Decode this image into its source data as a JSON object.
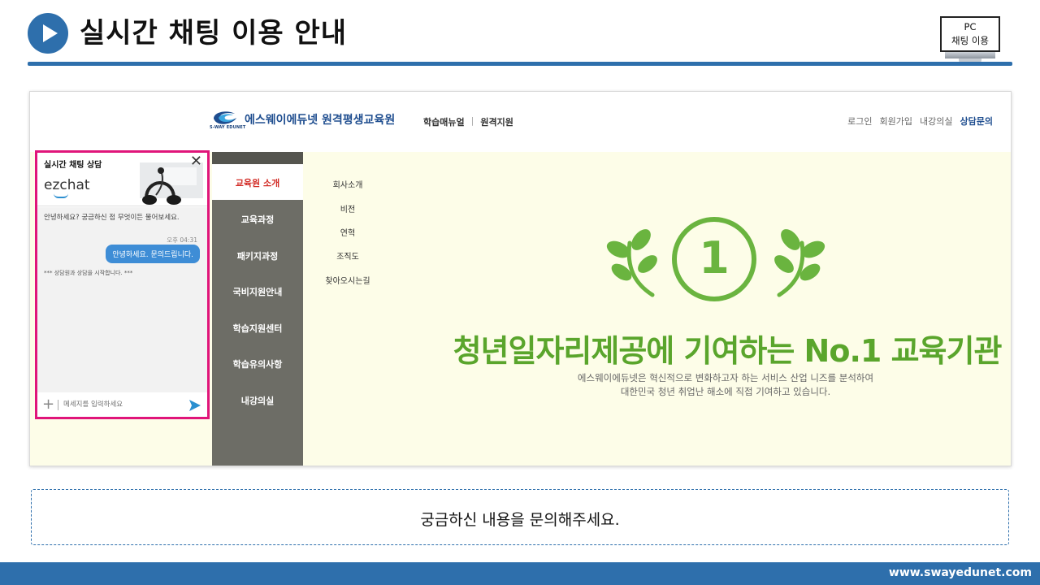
{
  "slide": {
    "title": "실시간 채팅 이용 안내",
    "badge_line1": "PC",
    "badge_line2": "채팅 이용",
    "note": "궁금하신 내용을 문의해주세요.",
    "footer_url": "www.swayedunet.com",
    "accent_color": "#2e6fac"
  },
  "site": {
    "logo_sub": "S-WAY EDUNET",
    "name": "에스웨이에듀넷 원격평생교육원",
    "gnb": [
      "학습매뉴얼",
      "원격지원"
    ],
    "gnb_separator": "|",
    "util": [
      "로그인",
      "회원가입",
      "내강의실",
      "상담문의"
    ]
  },
  "menu": {
    "items": [
      "교육원 소개",
      "교육과정",
      "패키지과정",
      "국비지원안내",
      "학습지원센터",
      "학습유의사항",
      "내강의실"
    ],
    "active_index": 0,
    "sub_items": [
      "회사소개",
      "비전",
      "연혁",
      "조직도",
      "찾아오시는길"
    ]
  },
  "hero": {
    "number": "1",
    "headline": "청년일자리제공에 기여하는 No.1 교육기관",
    "desc_line1": "에스웨이에듀넷은 혁신적으로 변화하고자 하는 서비스 산업 니즈를 분석하여",
    "desc_line2": "대한민국 청년 취업난 해소에 직접 기여하고 있습니다.",
    "color": "#6ab43f"
  },
  "chat": {
    "title": "실시간 채팅 상담",
    "close_label": "✕",
    "brand": "ezchat",
    "incoming_message": "안녕하세요? 궁금하신 점 무엇이든 물어보세요.",
    "incoming_time": "오후 04:31",
    "outgoing_message": "안녕하세요. 문의드립니다.",
    "system_message": "*** 상담원과 상담을 시작합니다. ***",
    "input_placeholder": "메세지를 입력하세요",
    "plus_label": "+",
    "highlight_color": "#e0157a"
  }
}
